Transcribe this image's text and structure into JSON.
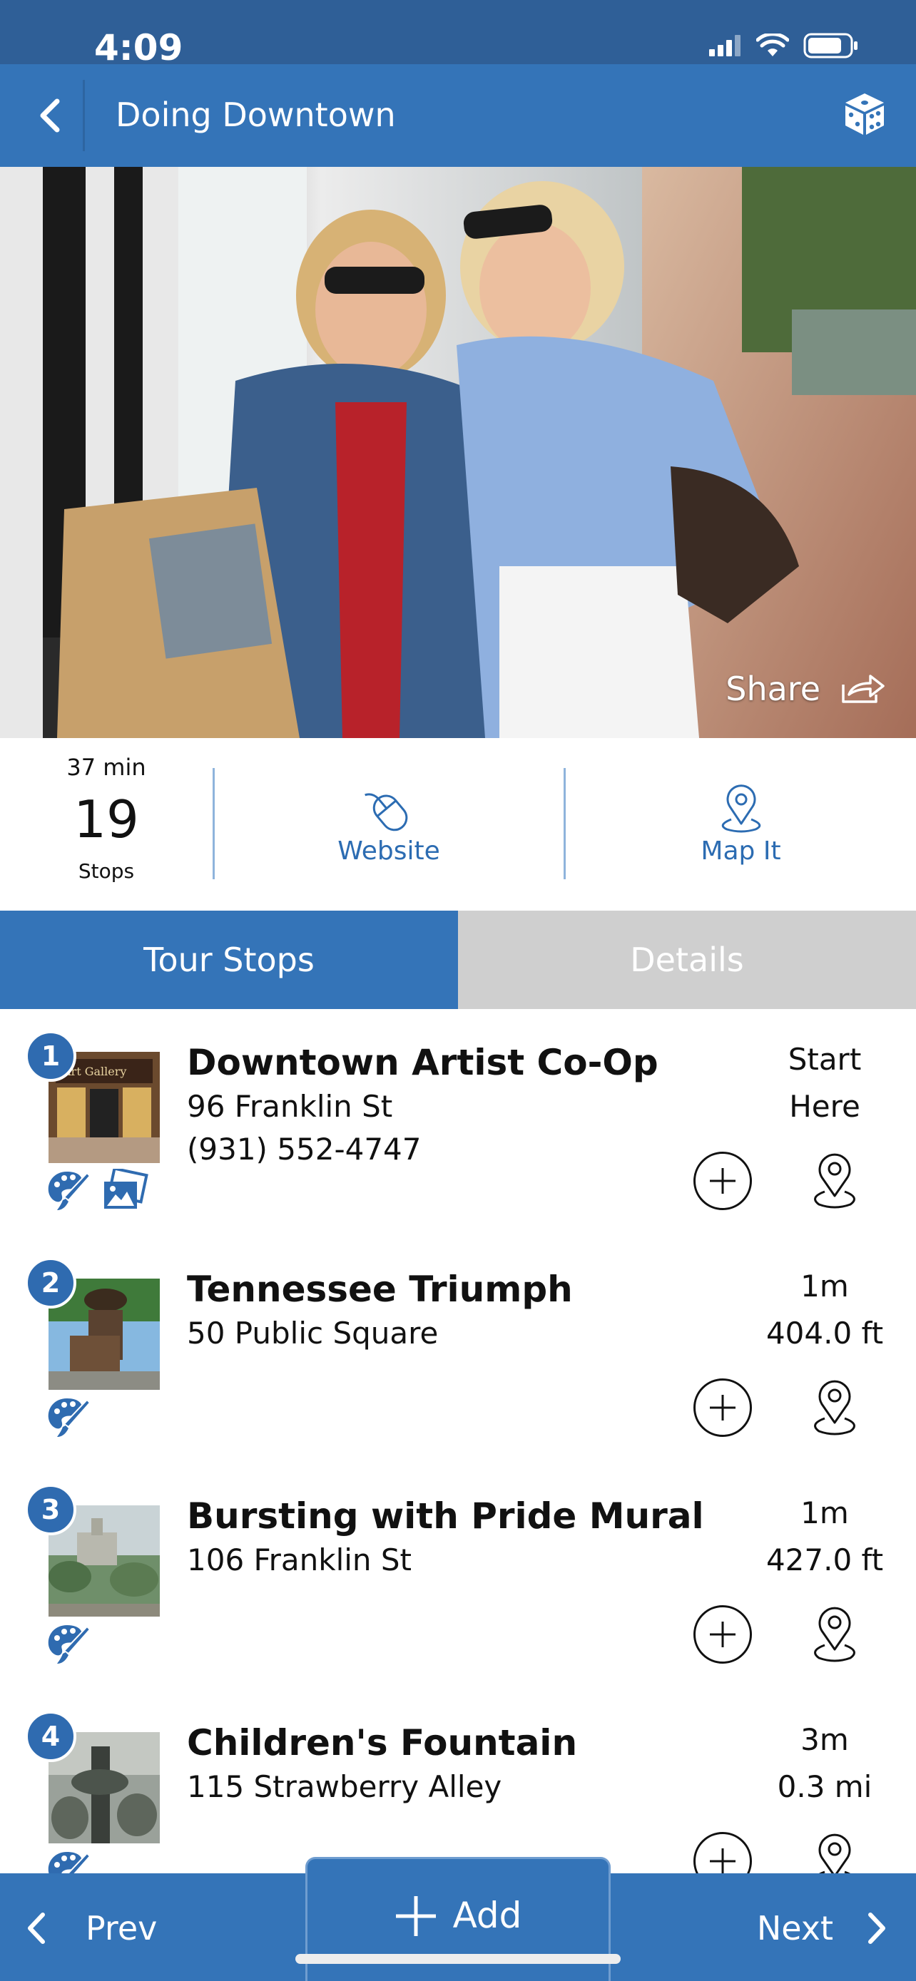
{
  "status": {
    "time": "4:09"
  },
  "nav": {
    "title": "Doing Downtown"
  },
  "hero": {
    "share_label": "Share"
  },
  "stats": {
    "duration": "37 min",
    "stop_count": "19",
    "stops_label": "Stops"
  },
  "actions": {
    "website_label": "Website",
    "map_label": "Map It"
  },
  "tabs": [
    {
      "label": "Tour Stops",
      "active": true
    },
    {
      "label": "Details",
      "active": false
    }
  ],
  "stops": [
    {
      "number": "1",
      "name": "Downtown Artist Co-Op",
      "address": "96 Franklin St",
      "phone": "(931) 552-4747",
      "dist_top": "Start",
      "dist_bottom": "Here",
      "categories": [
        "palette-icon",
        "image-gallery-icon"
      ]
    },
    {
      "number": "2",
      "name": "Tennessee Triumph",
      "address": "50 Public Square",
      "phone": "",
      "dist_top": "1m",
      "dist_bottom": "404.0 ft",
      "categories": [
        "palette-icon"
      ]
    },
    {
      "number": "3",
      "name": "Bursting with Pride Mural",
      "address": "106 Franklin St",
      "phone": "",
      "dist_top": "1m",
      "dist_bottom": "427.0 ft",
      "categories": [
        "palette-icon"
      ]
    },
    {
      "number": "4",
      "name": "Children's Fountain",
      "address": "115 Strawberry Alley",
      "phone": "",
      "dist_top": "3m",
      "dist_bottom": "0.3 mi",
      "categories": [
        "palette-icon"
      ]
    }
  ],
  "bottom": {
    "prev_label": "Prev",
    "add_label": "Add",
    "next_label": "Next"
  },
  "colors": {
    "primary": "#3474b8",
    "status_bar": "#2f5f97",
    "link": "#2c6cb2",
    "badge": "#2f6bb0",
    "inactive_tab": "#cfcfcf"
  }
}
